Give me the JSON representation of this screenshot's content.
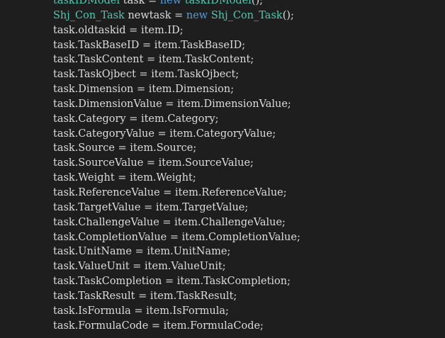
{
  "editor": {
    "lines": [
      [
        {
          "t": "taskIDModel",
          "c": "type"
        },
        {
          "t": " task = ",
          "c": "plain"
        },
        {
          "t": "new",
          "c": "kw"
        },
        {
          "t": " ",
          "c": "plain"
        },
        {
          "t": "taskIDModel",
          "c": "type"
        },
        {
          "t": "();",
          "c": "plain"
        }
      ],
      [
        {
          "t": "Shj_Con_Task",
          "c": "type"
        },
        {
          "t": " newtask = ",
          "c": "plain"
        },
        {
          "t": "new",
          "c": "kw"
        },
        {
          "t": " ",
          "c": "plain"
        },
        {
          "t": "Shj_Con_Task",
          "c": "type"
        },
        {
          "t": "();",
          "c": "plain"
        }
      ],
      [
        {
          "t": "task.oldtaskid = item.ID;",
          "c": "plain"
        }
      ],
      [
        {
          "t": "task.TaskBaseID = item.TaskBaseID;",
          "c": "plain"
        }
      ],
      [
        {
          "t": "task.TaskContent = item.TaskContent;",
          "c": "plain"
        }
      ],
      [
        {
          "t": "task.TaskOjbect = item.TaskOjbect;",
          "c": "plain"
        }
      ],
      [
        {
          "t": "task.Dimension = item.Dimension;",
          "c": "plain"
        }
      ],
      [
        {
          "t": "task.DimensionValue = item.DimensionValue;",
          "c": "plain"
        }
      ],
      [
        {
          "t": "task.Category = item.Category;",
          "c": "plain"
        }
      ],
      [
        {
          "t": "task.CategoryValue = item.CategoryValue;",
          "c": "plain"
        }
      ],
      [
        {
          "t": "task.Source = item.Source;",
          "c": "plain"
        }
      ],
      [
        {
          "t": "task.SourceValue = item.SourceValue;",
          "c": "plain"
        }
      ],
      [
        {
          "t": "task.Weight = item.Weight;",
          "c": "plain"
        }
      ],
      [
        {
          "t": "task.ReferenceValue = item.ReferenceValue;",
          "c": "plain"
        }
      ],
      [
        {
          "t": "task.TargetValue = item.TargetValue;",
          "c": "plain"
        }
      ],
      [
        {
          "t": "task.ChallengeValue = item.ChallengeValue;",
          "c": "plain"
        }
      ],
      [
        {
          "t": "task.CompletionValue = item.CompletionValue;",
          "c": "plain"
        }
      ],
      [
        {
          "t": "task.UnitName = item.UnitName;",
          "c": "plain"
        }
      ],
      [
        {
          "t": "task.ValueUnit = item.ValueUnit;",
          "c": "plain"
        }
      ],
      [
        {
          "t": "task.TaskCompletion = item.TaskCompletion;",
          "c": "plain"
        }
      ],
      [
        {
          "t": "task.TaskResult = item.TaskResult;",
          "c": "plain"
        }
      ],
      [
        {
          "t": "task.IsFormula = item.IsFormula;",
          "c": "plain"
        }
      ],
      [
        {
          "t": "task.FormulaCode = item.FormulaCode;",
          "c": "plain"
        }
      ]
    ],
    "colors": {
      "background": "#1e1e1e",
      "text": "#dcdcdc",
      "type": "#4ec9b0",
      "keyword": "#569cd6"
    }
  }
}
